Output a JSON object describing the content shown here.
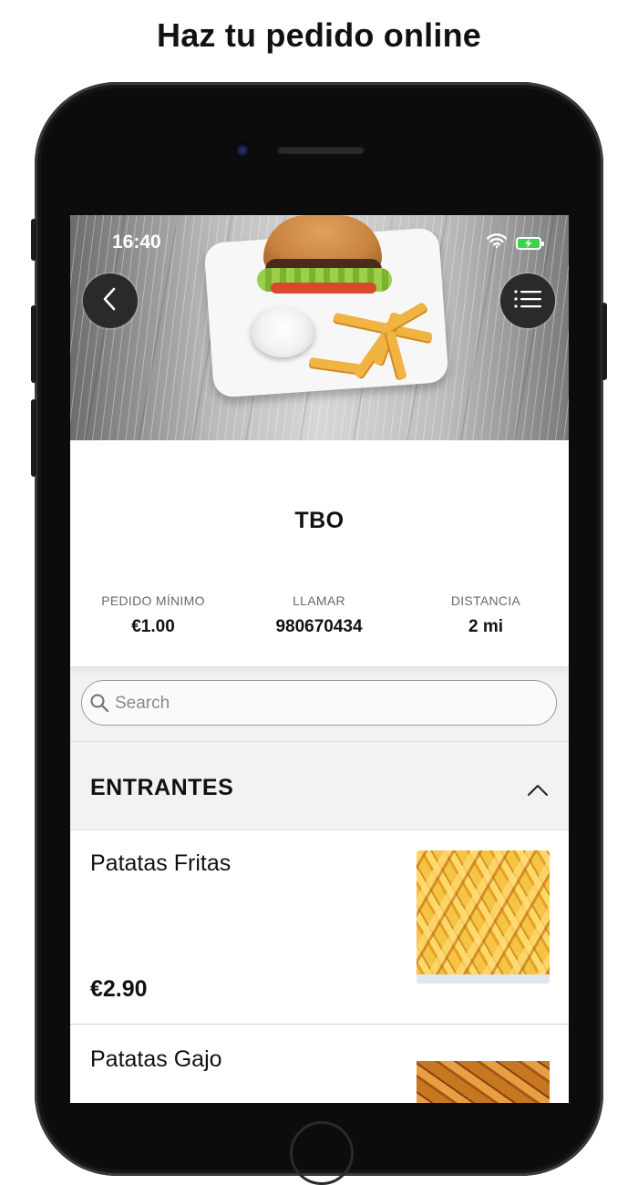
{
  "headline": "Haz tu pedido online",
  "status_bar": {
    "time": "16:40"
  },
  "store": {
    "name": "TBO",
    "stats": [
      {
        "label": "PEDIDO MÍNIMO",
        "value": "€1.00"
      },
      {
        "label": "LLAMAR",
        "value": "980670434"
      },
      {
        "label": "DISTANCIA",
        "value": "2 mi"
      }
    ]
  },
  "search": {
    "placeholder": "Search",
    "value": ""
  },
  "category": {
    "title": "ENTRANTES",
    "expanded": true
  },
  "items": [
    {
      "name": "Patatas Fritas",
      "price": "€2.90",
      "image": "fries-photo"
    },
    {
      "name": "Patatas Gajo",
      "image": "potato-wedges-photo"
    }
  ],
  "icons": {
    "back": "chevron-left-icon",
    "menu": "list-icon",
    "search": "magnifier-icon",
    "collapse": "chevron-up-icon",
    "wifi": "wifi-icon",
    "battery": "battery-charging-icon"
  },
  "colors": {
    "battery_fill": "#3cd34a",
    "button_bg": "#2a2a2a",
    "text_primary": "#111111"
  }
}
